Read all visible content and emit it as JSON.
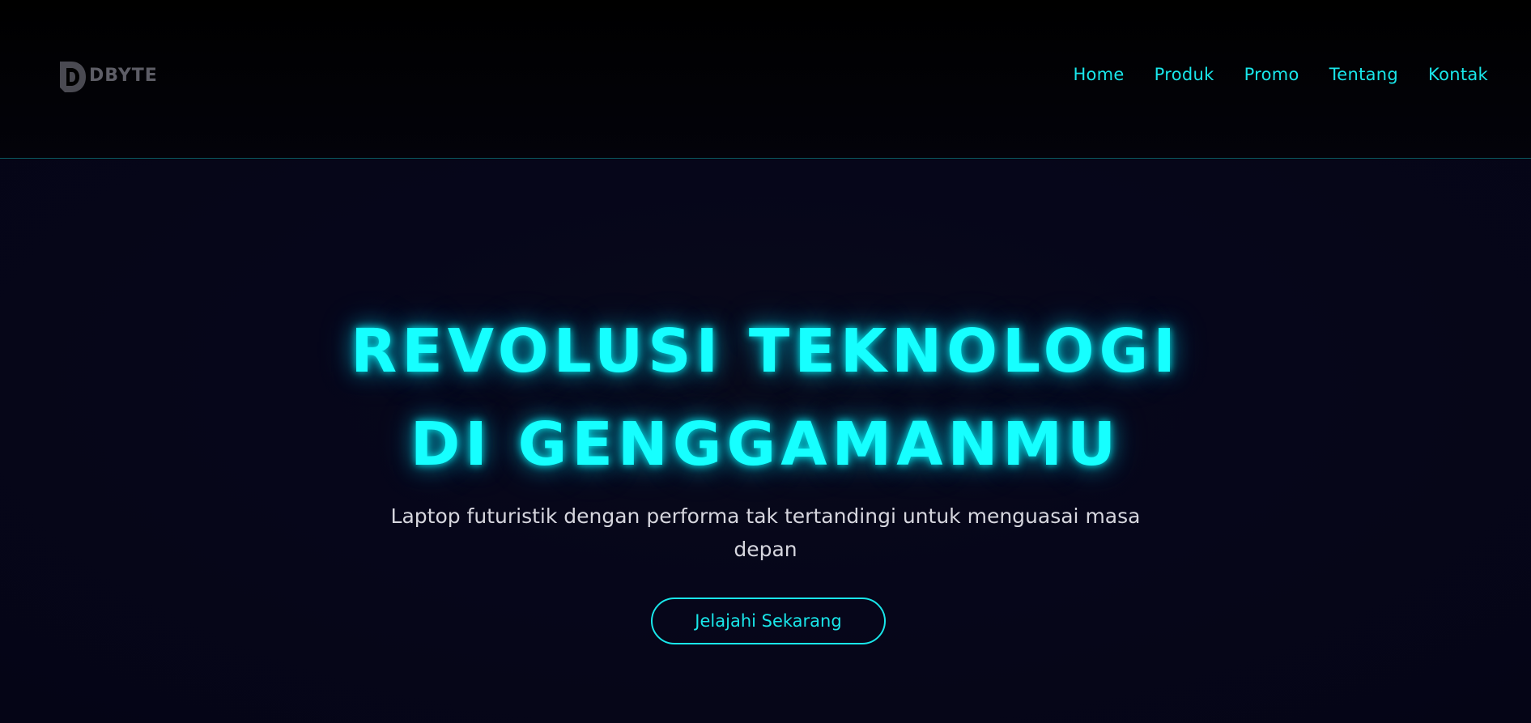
{
  "brand": {
    "name": "DBYTE",
    "logo_icon": "dbyte-d-logo-icon",
    "logo_color": "#5d5d66"
  },
  "nav": {
    "items": [
      {
        "label": "Home"
      },
      {
        "label": "Produk"
      },
      {
        "label": "Promo"
      },
      {
        "label": "Tentang"
      },
      {
        "label": "Kontak"
      }
    ],
    "color": "#19e6ea"
  },
  "hero": {
    "title_line1": "REVOLUSI TEKNOLOGI",
    "title_line2": "DI GENGGAMANMU",
    "subtitle_line1": "Laptop futuristik dengan performa tak tertandingi untuk menguasai masa",
    "subtitle_line2": "depan",
    "cta_label": "Jelajahi Sekarang",
    "accent_color": "#16ffff",
    "background_color": "#05050f"
  }
}
